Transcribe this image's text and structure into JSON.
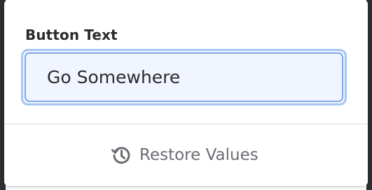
{
  "field": {
    "label": "Button Text",
    "value": "Go Somewhere",
    "placeholder": ""
  },
  "footer": {
    "restore_label": "Restore Values",
    "restore_icon": "history-icon"
  },
  "colors": {
    "focus_ring": "#7fa8ea",
    "input_background": "#f0f5ff",
    "muted_text": "#6a6d72"
  }
}
